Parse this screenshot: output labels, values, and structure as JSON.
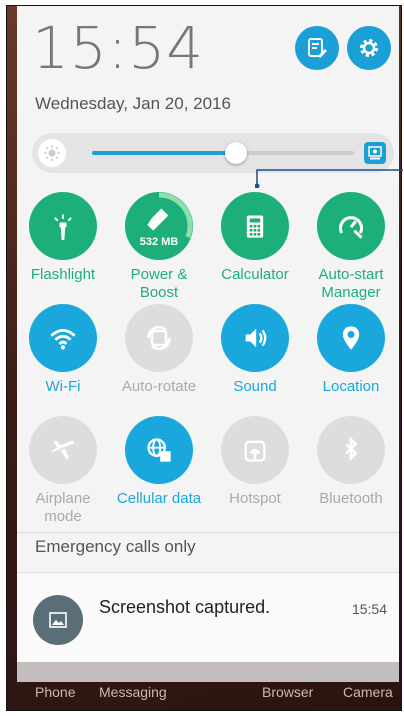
{
  "status": {
    "time": "15:54",
    "date": "Wednesday, Jan 20, 2016"
  },
  "header_buttons": {
    "edit_icon": "edit-notes-icon",
    "settings_icon": "settings-gear-icon"
  },
  "brightness": {
    "level": 0.55,
    "low_icon": "brightness-low-icon",
    "auto_icon": "auto-brightness-icon"
  },
  "tiles": [
    {
      "label": "Flashlight",
      "icon": "flashlight-icon",
      "state": "on"
    },
    {
      "label": "Power & Boost",
      "badge": "532 MB",
      "icon": "broom-icon",
      "state": "on"
    },
    {
      "label": "Calculator",
      "icon": "calculator-icon",
      "state": "on"
    },
    {
      "label": "Auto-start Manager",
      "icon": "auto-start-icon",
      "state": "on"
    },
    {
      "label": "Wi-Fi",
      "icon": "wifi-icon",
      "state": "on"
    },
    {
      "label": "Auto-rotate",
      "icon": "rotate-icon",
      "state": "off"
    },
    {
      "label": "Sound",
      "icon": "sound-icon",
      "state": "on"
    },
    {
      "label": "Location",
      "icon": "location-icon",
      "state": "on"
    },
    {
      "label": "Airplane mode",
      "icon": "airplane-icon",
      "state": "off"
    },
    {
      "label": "Cellular data",
      "icon": "cellular-icon",
      "state": "on"
    },
    {
      "label": "Hotspot",
      "icon": "hotspot-icon",
      "state": "off"
    },
    {
      "label": "Bluetooth",
      "icon": "bluetooth-icon",
      "state": "off"
    }
  ],
  "emergency": "Emergency calls only",
  "notification": {
    "title": "Screenshot captured.",
    "time": "15:54",
    "icon": "image-icon"
  },
  "dock": [
    "Phone",
    "Messaging",
    "Browser",
    "Camera"
  ],
  "colors": {
    "accent_blue": "#1aa8dc",
    "accent_green": "#1daf7a",
    "inactive_grey": "#dddddd"
  }
}
